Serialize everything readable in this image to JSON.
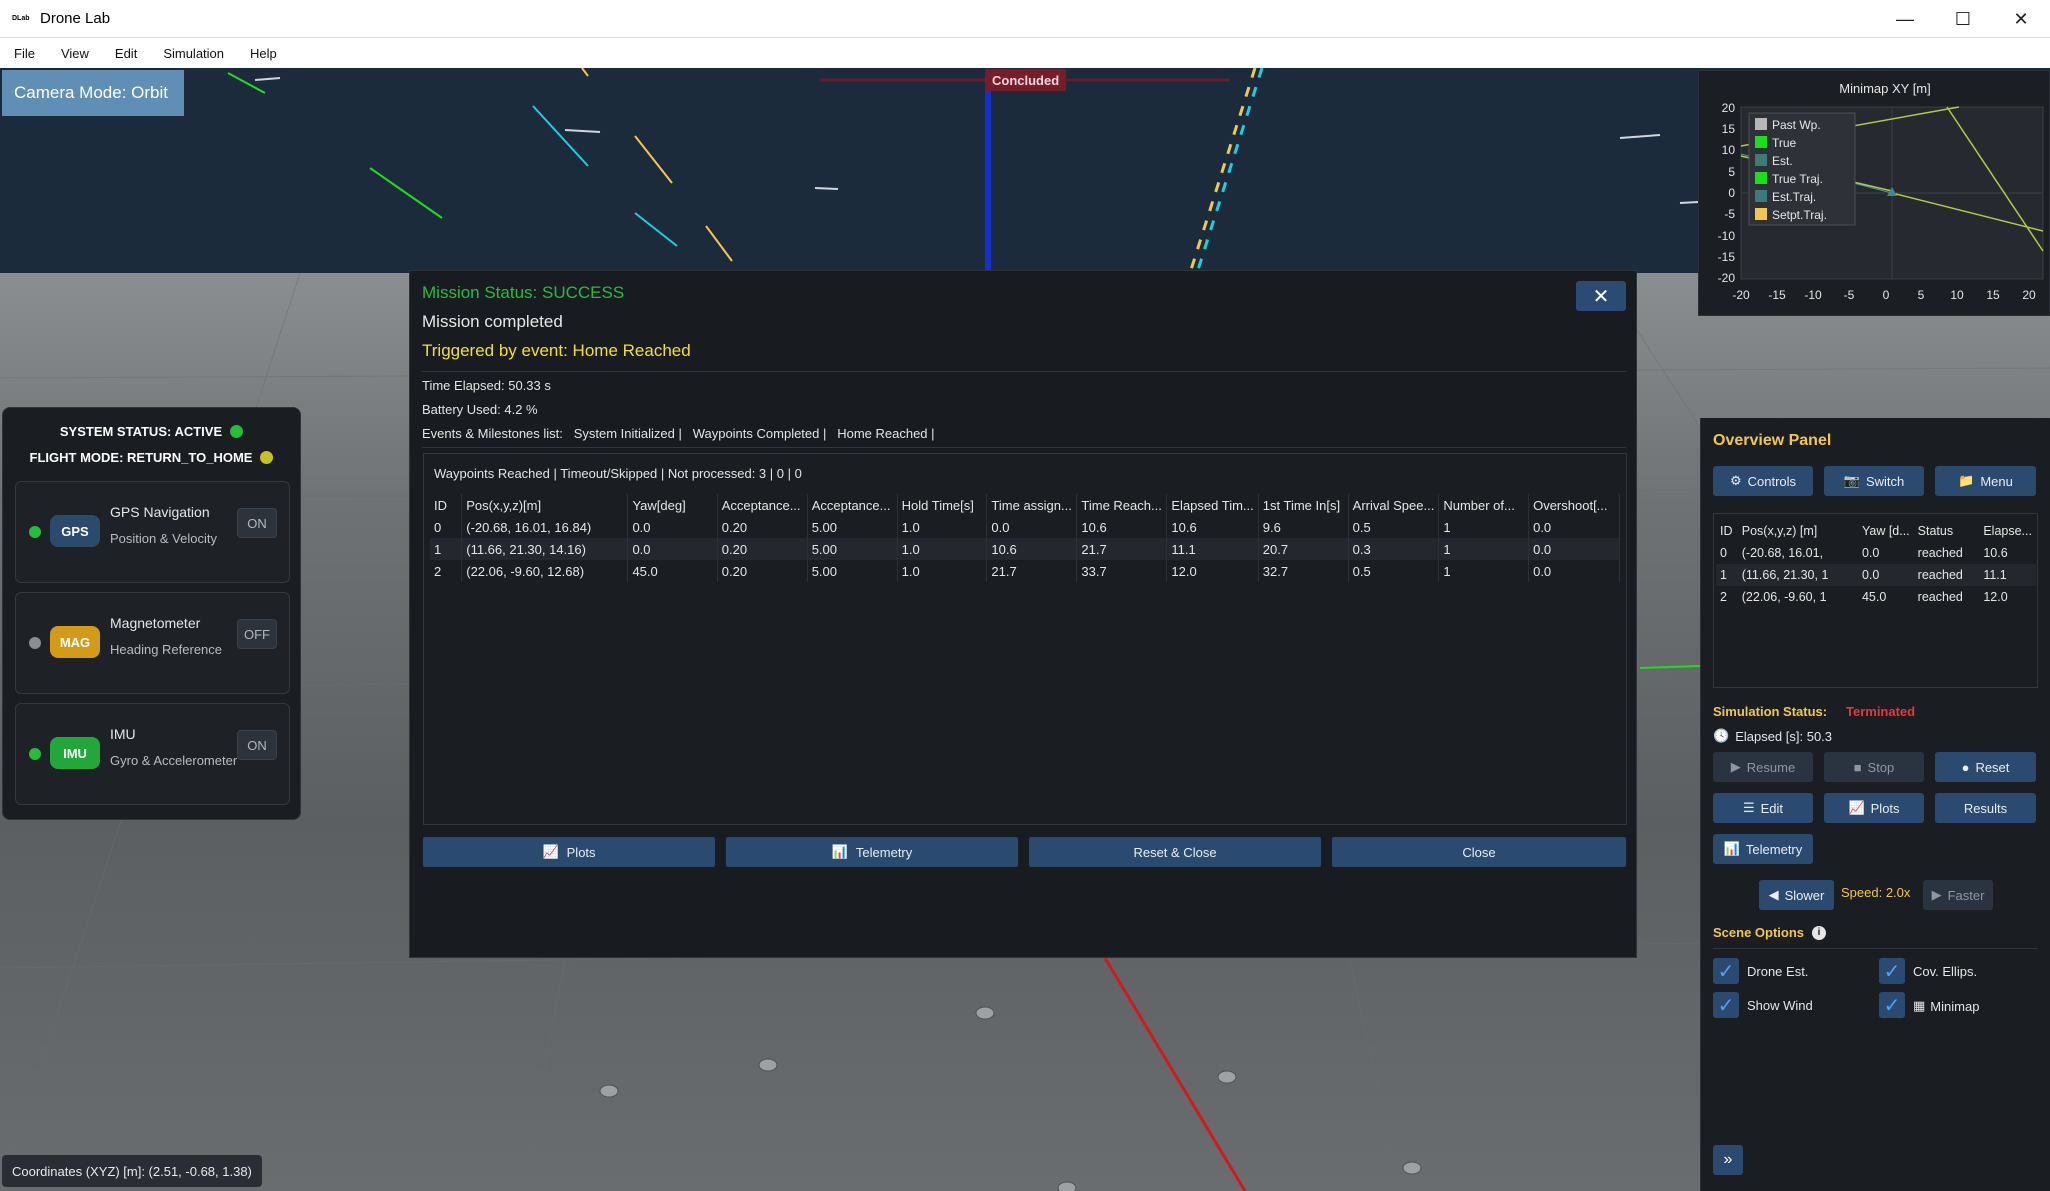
{
  "window": {
    "title": "Drone Lab",
    "logo_text": "DLab",
    "minimize": "—",
    "maximize": "☐",
    "close": "✕"
  },
  "menu": [
    "File",
    "View",
    "Edit",
    "Simulation",
    "Help"
  ],
  "viewport": {
    "camera_mode": "Camera Mode: Orbit",
    "concluded_label": "Concluded",
    "coordinates": "Coordinates (XYZ) [m]: (2.51, -0.68, 1.38)"
  },
  "status_panel": {
    "system_status": "SYSTEM STATUS: ACTIVE",
    "system_status_color": "#22c03a",
    "flight_mode": "FLIGHT MODE: RETURN_TO_HOME",
    "flight_mode_color": "#c9c022",
    "sensors": [
      {
        "badge": "GPS",
        "name": "GPS Navigation",
        "desc": "Position & Velocity",
        "toggle": "ON",
        "status_color": "#22c03a",
        "badge_color": "#2a4a6e",
        "badge_text_color": "#ffffff"
      },
      {
        "badge": "MAG",
        "name": "Magnetometer",
        "desc": "Heading Reference",
        "toggle": "OFF",
        "status_color": "#8a8d92",
        "badge_color": "#d39b18",
        "badge_text_color": "#ffffff"
      },
      {
        "badge": "IMU",
        "name": "IMU",
        "desc": "Gyro & Accelerometer",
        "toggle": "ON",
        "status_color": "#22c03a",
        "badge_color": "#22a83a",
        "badge_text_color": "#ffffff"
      }
    ]
  },
  "minimap": {
    "title": "Minimap XY [m]",
    "legend": [
      {
        "label": "Past Wp.",
        "color": "#b7b7b7"
      },
      {
        "label": "True",
        "color": "#19e019"
      },
      {
        "label": "Est.",
        "color": "#3d7a7a"
      },
      {
        "label": "True Traj.",
        "color": "#19e019"
      },
      {
        "label": "Est.Traj.",
        "color": "#3d7a7a"
      },
      {
        "label": "Setpt.Traj.",
        "color": "#f2c84b"
      }
    ],
    "y_ticks": [
      "20",
      "15",
      "10",
      "5",
      "0",
      "-5",
      "-10",
      "-15",
      "-20"
    ],
    "x_ticks": [
      "-20",
      "-15",
      "-10",
      "-5",
      "0",
      "5",
      "10",
      "15",
      "20"
    ]
  },
  "dialog": {
    "status": "Mission Status: SUCCESS",
    "completed": "Mission completed",
    "triggered": "Triggered by event: Home Reached",
    "time_elapsed": "Time Elapsed: 50.33 s",
    "battery": "Battery Used: 4.2 %",
    "events": "Events & Milestones list:   System Initialized |   Waypoints Completed |   Home Reached |",
    "close_icon": "✕",
    "summary": "Waypoints Reached | Timeout/Skipped | Not processed: 3 | 0 | 0",
    "columns": [
      "ID",
      "Pos(x,y,z)[m]",
      "Yaw[deg]",
      "Acceptance...",
      "Acceptance...",
      "Hold Time[s]",
      "Time assign...",
      "Time Reach...",
      "Elapsed Tim...",
      "1st Time In[s]",
      "Arrival Spee...",
      "Number of...",
      "Overshoot[..."
    ],
    "rows": [
      [
        "0",
        "(-20.68, 16.01, 16.84)",
        "0.0",
        "0.20",
        "5.00",
        "1.0",
        "0.0",
        "10.6",
        "10.6",
        "9.6",
        "0.5",
        "1",
        "0.0"
      ],
      [
        "1",
        "(11.66, 21.30, 14.16)",
        "0.0",
        "0.20",
        "5.00",
        "1.0",
        "10.6",
        "21.7",
        "11.1",
        "20.7",
        "0.3",
        "1",
        "0.0"
      ],
      [
        "2",
        "(22.06, -9.60, 12.68)",
        "45.0",
        "0.20",
        "5.00",
        "1.0",
        "21.7",
        "33.7",
        "12.0",
        "32.7",
        "0.5",
        "1",
        "0.0"
      ]
    ],
    "buttons": {
      "plots": "Plots",
      "telemetry": "Telemetry",
      "reset_close": "Reset & Close",
      "close": "Close"
    }
  },
  "overview": {
    "title": "Overview Panel",
    "controls": "Controls",
    "switch": "Switch",
    "menu": "Menu",
    "columns": [
      "ID",
      "Pos(x,y,z) [m]",
      "Yaw [d...",
      "Status",
      "Elapse..."
    ],
    "rows": [
      [
        "0",
        "(-20.68, 16.01,",
        "0.0",
        "reached",
        "10.6"
      ],
      [
        "1",
        "(11.66, 21.30, 1",
        "0.0",
        "reached",
        "11.1"
      ],
      [
        "2",
        "(22.06, -9.60, 1",
        "45.0",
        "reached",
        "12.0"
      ]
    ],
    "sim_status_label": "Simulation Status:",
    "sim_status_value": "Terminated",
    "elapsed": "Elapsed [s]: 50.3",
    "resume": "Resume",
    "stop": "Stop",
    "reset": "Reset",
    "edit": "Edit",
    "plots": "Plots",
    "results": "Results",
    "telemetry": "Telemetry",
    "slower": "Slower",
    "speed": "Speed: 2.0x",
    "faster": "Faster",
    "scene_options": "Scene Options",
    "options": {
      "drone_est": "Drone Est.",
      "cov_ellips": "Cov. Ellips.",
      "show_wind": "Show Wind",
      "minimap": "Minimap"
    }
  }
}
